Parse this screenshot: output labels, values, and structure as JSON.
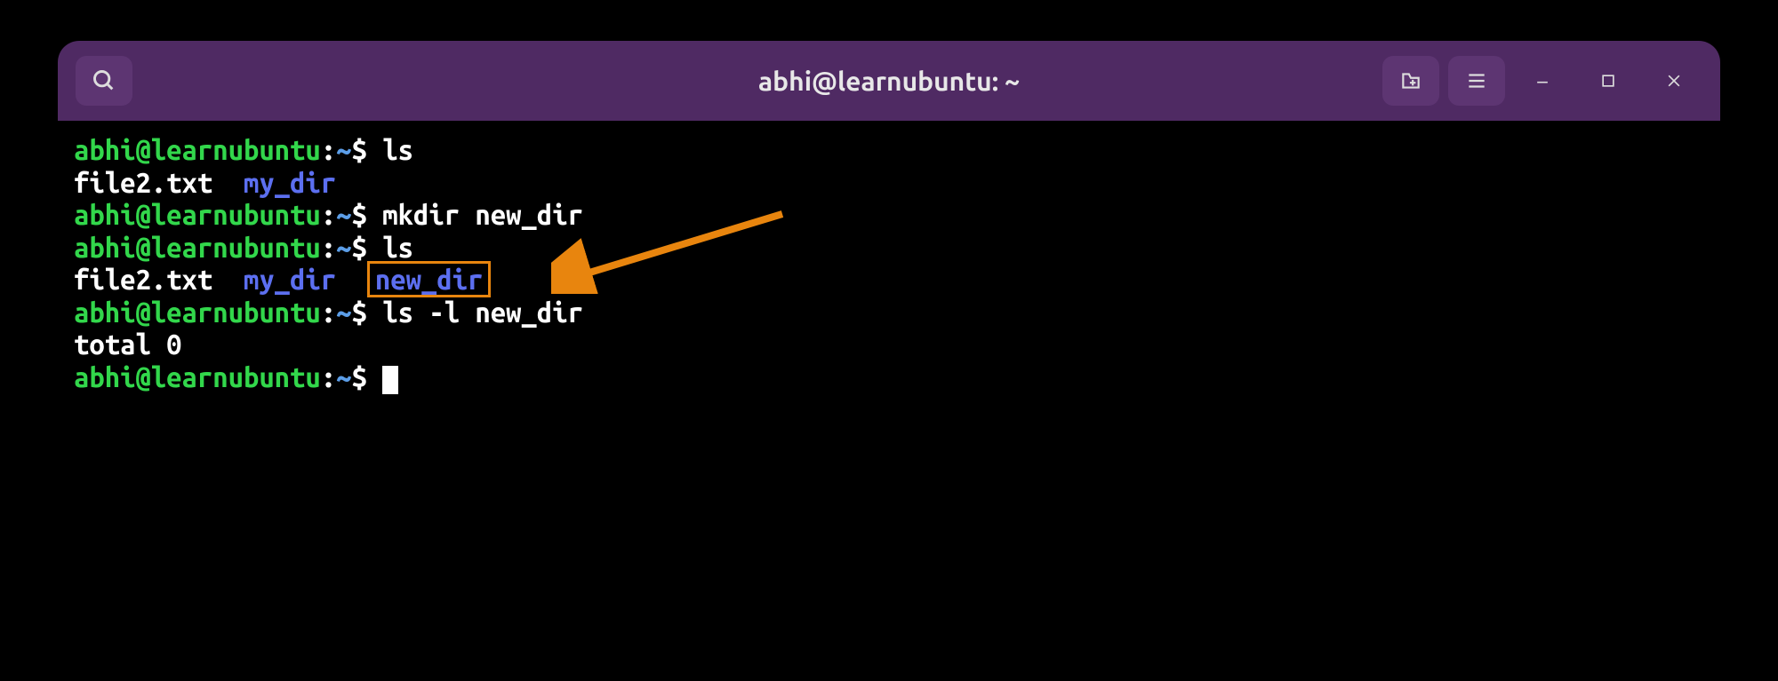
{
  "window": {
    "title": "abhi@learnubuntu: ~"
  },
  "prompt": {
    "user_host": "abhi@learnubuntu",
    "colon": ":",
    "path": "~",
    "dollar": "$"
  },
  "lines": {
    "l1_cmd": "ls",
    "l2_file": "file2.txt",
    "l2_dir": "my_dir",
    "l3_cmd": "mkdir new_dir",
    "l4_cmd": "ls",
    "l5_file": "file2.txt",
    "l5_dir1": "my_dir",
    "l5_dir2": "new_dir",
    "l6_cmd": "ls -l new_dir",
    "l7_output": "total 0"
  },
  "colors": {
    "titlebar": "#4f2a63",
    "button_bg": "#5d3572",
    "prompt_green": "#32d74b",
    "prompt_blue": "#5c9ee8",
    "dir_blue": "#5c6ff0",
    "annotation": "#e8850e"
  },
  "icons": {
    "search": "search-icon",
    "new_tab": "new-tab-icon",
    "menu": "hamburger-icon",
    "minimize": "minimize-icon",
    "maximize": "maximize-icon",
    "close": "close-icon"
  }
}
